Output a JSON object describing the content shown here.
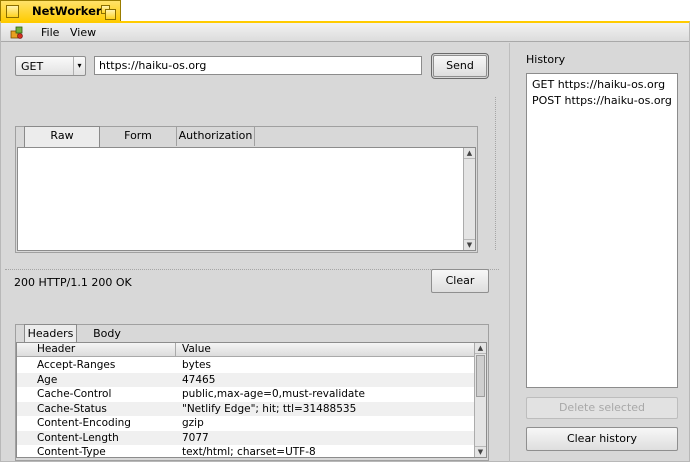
{
  "window": {
    "title": "NetWorker"
  },
  "menubar": {
    "items": [
      "File",
      "View"
    ]
  },
  "request": {
    "method": "GET",
    "url": "https://haiku-os.org",
    "send_label": "Send",
    "tabs": [
      "Raw",
      "Form",
      "Authorization"
    ],
    "active_tab": "Raw",
    "body": ""
  },
  "response": {
    "status": "200 HTTP/1.1 200 OK",
    "clear_label": "Clear",
    "tabs": [
      "Headers",
      "Body"
    ],
    "active_tab": "Headers",
    "columns": [
      "Header",
      "Value"
    ],
    "rows": [
      [
        "Accept-Ranges",
        "bytes"
      ],
      [
        "Age",
        "47465"
      ],
      [
        "Cache-Control",
        "public,max-age=0,must-revalidate"
      ],
      [
        "Cache-Status",
        "\"Netlify Edge\"; hit; ttl=31488535"
      ],
      [
        "Content-Encoding",
        "gzip"
      ],
      [
        "Content-Length",
        "7077"
      ],
      [
        "Content-Type",
        "text/html; charset=UTF-8"
      ]
    ]
  },
  "history": {
    "title": "History",
    "items": [
      "GET https://haiku-os.org",
      "POST https://haiku-os.org"
    ],
    "delete_label": "Delete selected",
    "clear_label": "Clear history"
  },
  "colors": {
    "tab_yellow": "#ffcb00",
    "window_bg": "#d8d8d8"
  }
}
